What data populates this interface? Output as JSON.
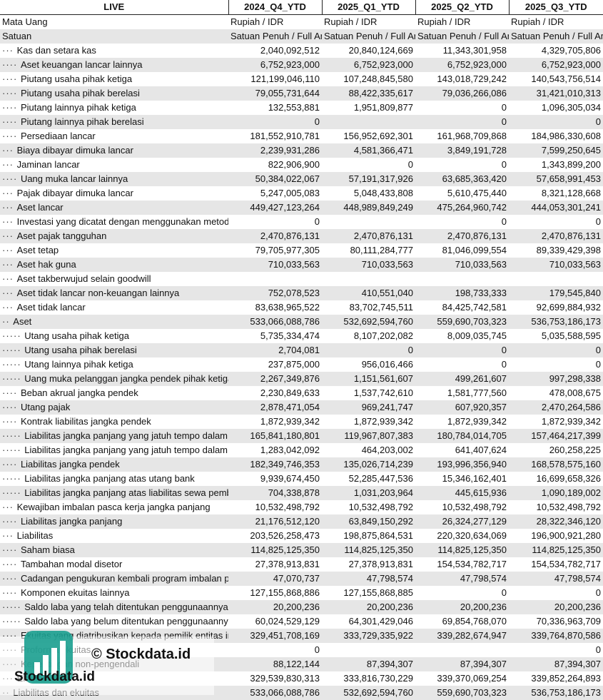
{
  "header": {
    "title": "LIVE",
    "periods": [
      "2024_Q4_YTD",
      "2025_Q1_YTD",
      "2025_Q2_YTD",
      "2025_Q3_YTD"
    ]
  },
  "meta_rows": [
    {
      "label": "Mata Uang",
      "values": [
        "Rupiah / IDR",
        "Rupiah / IDR",
        "Rupiah / IDR",
        "Rupiah / IDR"
      ]
    },
    {
      "label": "Satuan",
      "values": [
        "Satuan Penuh / Full Amount",
        "Satuan Penuh / Full Amount",
        "Satuan Penuh / Full Amount",
        "Satuan Penuh / Full Amount"
      ]
    }
  ],
  "rows": [
    {
      "level": 3,
      "label": "Kas dan setara kas",
      "values": [
        "2,040,092,512",
        "20,840,124,669",
        "11,343,301,958",
        "4,329,705,806"
      ]
    },
    {
      "level": 4,
      "label": "Aset keuangan lancar lainnya",
      "values": [
        "6,752,923,000",
        "6,752,923,000",
        "6,752,923,000",
        "6,752,923,000"
      ]
    },
    {
      "level": 4,
      "label": "Piutang usaha pihak ketiga",
      "values": [
        "121,199,046,110",
        "107,248,845,580",
        "143,018,729,242",
        "140,543,756,514"
      ]
    },
    {
      "level": 4,
      "label": "Piutang usaha pihak berelasi",
      "values": [
        "79,055,731,644",
        "88,422,335,617",
        "79,036,266,086",
        "31,421,010,313"
      ]
    },
    {
      "level": 4,
      "label": "Piutang lainnya pihak ketiga",
      "values": [
        "132,553,881",
        "1,951,809,877",
        "0",
        "1,096,305,034"
      ]
    },
    {
      "level": 4,
      "label": "Piutang lainnya pihak berelasi",
      "values": [
        "0",
        "",
        "0",
        "0"
      ]
    },
    {
      "level": 4,
      "label": "Persediaan lancar",
      "values": [
        "181,552,910,781",
        "156,952,692,301",
        "161,968,709,868",
        "184,986,330,608"
      ]
    },
    {
      "level": 3,
      "label": "Biaya dibayar dimuka lancar",
      "values": [
        "2,239,931,286",
        "4,581,366,471",
        "3,849,191,728",
        "7,599,250,645"
      ]
    },
    {
      "level": 3,
      "label": "Jaminan lancar",
      "values": [
        "822,906,900",
        "0",
        "0",
        "1,343,899,200"
      ]
    },
    {
      "level": 4,
      "label": "Uang muka lancar lainnya",
      "values": [
        "50,384,022,067",
        "57,191,317,926",
        "63,685,363,420",
        "57,658,991,453"
      ]
    },
    {
      "level": 3,
      "label": "Pajak dibayar dimuka lancar",
      "values": [
        "5,247,005,083",
        "5,048,433,808",
        "5,610,475,440",
        "8,321,128,668"
      ]
    },
    {
      "level": 3,
      "label": "Aset lancar",
      "values": [
        "449,427,123,264",
        "448,989,849,249",
        "475,264,960,742",
        "444,053,301,241"
      ]
    },
    {
      "level": 3,
      "label": "Investasi yang dicatat dengan menggunakan metode ekuitas",
      "values": [
        "0",
        "",
        "0",
        "0"
      ]
    },
    {
      "level": 3,
      "label": "Aset pajak tangguhan",
      "values": [
        "2,470,876,131",
        "2,470,876,131",
        "2,470,876,131",
        "2,470,876,131"
      ]
    },
    {
      "level": 3,
      "label": "Aset tetap",
      "values": [
        "79,705,977,305",
        "80,111,284,777",
        "81,046,099,554",
        "89,339,429,398"
      ]
    },
    {
      "level": 3,
      "label": "Aset hak guna",
      "values": [
        "710,033,563",
        "710,033,563",
        "710,033,563",
        "710,033,563"
      ]
    },
    {
      "level": 3,
      "label": "Aset takberwujud selain goodwill",
      "values": [
        "",
        "",
        "",
        ""
      ]
    },
    {
      "level": 3,
      "label": "Aset tidak lancar non-keuangan lainnya",
      "values": [
        "752,078,523",
        "410,551,040",
        "198,733,333",
        "179,545,840"
      ]
    },
    {
      "level": 3,
      "label": "Aset tidak lancar",
      "values": [
        "83,638,965,522",
        "83,702,745,511",
        "84,425,742,581",
        "92,699,884,932"
      ]
    },
    {
      "level": 2,
      "label": "Aset",
      "values": [
        "533,066,088,786",
        "532,692,594,760",
        "559,690,703,323",
        "536,753,186,173"
      ]
    },
    {
      "level": 5,
      "label": "Utang usaha pihak ketiga",
      "values": [
        "5,735,334,474",
        "8,107,202,082",
        "8,009,035,745",
        "5,035,588,595"
      ]
    },
    {
      "level": 5,
      "label": "Utang usaha pihak berelasi",
      "values": [
        "2,704,081",
        "0",
        "0",
        "0"
      ]
    },
    {
      "level": 5,
      "label": "Utang lainnya pihak ketiga",
      "values": [
        "237,875,000",
        "956,016,466",
        "0",
        "0"
      ]
    },
    {
      "level": 5,
      "label": "Uang muka pelanggan jangka pendek pihak ketiga",
      "values": [
        "2,267,349,876",
        "1,151,561,607",
        "499,261,607",
        "997,298,338"
      ]
    },
    {
      "level": 4,
      "label": "Beban akrual jangka pendek",
      "values": [
        "2,230,849,633",
        "1,537,742,610",
        "1,581,777,560",
        "478,008,675"
      ]
    },
    {
      "level": 4,
      "label": "Utang pajak",
      "values": [
        "2,878,471,054",
        "969,241,747",
        "607,920,357",
        "2,470,264,586"
      ]
    },
    {
      "level": 4,
      "label": "Kontrak liabilitas jangka pendek",
      "values": [
        "1,872,939,342",
        "1,872,939,342",
        "1,872,939,342",
        "1,872,939,342"
      ]
    },
    {
      "level": 5,
      "label": "Liabilitas jangka panjang yang jatuh tempo dalam satu tahun",
      "values": [
        "165,841,180,801",
        "119,967,807,383",
        "180,784,014,705",
        "157,464,217,399"
      ]
    },
    {
      "level": 5,
      "label": "Liabilitas jangka panjang yang jatuh tempo dalam satu tahun",
      "values": [
        "1,283,042,092",
        "464,203,002",
        "641,407,624",
        "260,258,225"
      ]
    },
    {
      "level": 4,
      "label": "Liabilitas jangka pendek",
      "values": [
        "182,349,746,353",
        "135,026,714,239",
        "193,996,356,940",
        "168,578,575,160"
      ]
    },
    {
      "level": 5,
      "label": "Liabilitas jangka panjang atas utang bank",
      "values": [
        "9,939,674,450",
        "52,285,447,536",
        "15,346,162,401",
        "16,699,658,326"
      ]
    },
    {
      "level": 5,
      "label": "Liabilitas jangka panjang atas liabilitas sewa pembiayaan",
      "values": [
        "704,338,878",
        "1,031,203,964",
        "445,615,936",
        "1,090,189,002"
      ]
    },
    {
      "level": 3,
      "label": "Kewajiban imbalan pasca kerja jangka panjang",
      "values": [
        "10,532,498,792",
        "10,532,498,792",
        "10,532,498,792",
        "10,532,498,792"
      ]
    },
    {
      "level": 4,
      "label": "Liabilitas jangka panjang",
      "values": [
        "21,176,512,120",
        "63,849,150,292",
        "26,324,277,129",
        "28,322,346,120"
      ]
    },
    {
      "level": 3,
      "label": "Liabilitas",
      "values": [
        "203,526,258,473",
        "198,875,864,531",
        "220,320,634,069",
        "196,900,921,280"
      ]
    },
    {
      "level": 4,
      "label": "Saham biasa",
      "values": [
        "114,825,125,350",
        "114,825,125,350",
        "114,825,125,350",
        "114,825,125,350"
      ]
    },
    {
      "level": 4,
      "label": "Tambahan modal disetor",
      "values": [
        "27,378,913,831",
        "27,378,913,831",
        "154,534,782,717",
        "154,534,782,717"
      ]
    },
    {
      "level": 4,
      "label": "Cadangan pengukuran kembali program imbalan pasti",
      "values": [
        "47,070,737",
        "47,798,574",
        "47,798,574",
        "47,798,574"
      ]
    },
    {
      "level": 4,
      "label": "Komponen ekuitas lainnya",
      "values": [
        "127,155,868,886",
        "127,155,868,885",
        "0",
        "0"
      ]
    },
    {
      "level": 5,
      "label": "Saldo laba yang telah ditentukan penggunaannya",
      "values": [
        "20,200,236",
        "20,200,236",
        "20,200,236",
        "20,200,236"
      ]
    },
    {
      "level": 5,
      "label": "Saldo laba yang belum ditentukan penggunaannya",
      "values": [
        "60,024,529,129",
        "64,301,429,046",
        "69,854,768,070",
        "70,336,963,709"
      ]
    },
    {
      "level": 4,
      "label": "Ekuitas yang diatribusikan kepada pemilik entitas induk",
      "values": [
        "329,451,708,169",
        "333,729,335,922",
        "339,282,674,947",
        "339,764,870,586"
      ]
    },
    {
      "level": 4,
      "label": "Proforma ekuitas",
      "values": [
        "0",
        "",
        "",
        "0"
      ]
    },
    {
      "level": 4,
      "label": "Kepentingan non-pengendali",
      "values": [
        "88,122,144",
        "87,394,307",
        "87,394,307",
        "87,394,307"
      ]
    },
    {
      "level": 3,
      "label": "Ekuitas",
      "values": [
        "329,539,830,313",
        "333,816,730,229",
        "339,370,069,254",
        "339,852,264,893"
      ]
    },
    {
      "level": 2,
      "label": "Liabilitas dan ekuitas",
      "values": [
        "533,066,088,786",
        "532,692,594,760",
        "559,690,703,323",
        "536,753,186,173"
      ]
    }
  ],
  "watermark": {
    "copyright": "© Stockdata.id",
    "brand": "Stockdata.id",
    "logo_icon": "bar-chart-icon",
    "logo_color": "#1a9e8f"
  }
}
